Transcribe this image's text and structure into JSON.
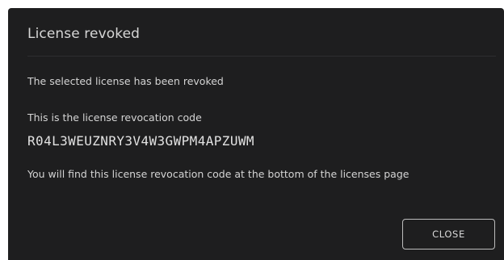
{
  "dialog": {
    "title": "License revoked",
    "message_revoked": "The selected license has been revoked",
    "code_label": "This is the license revocation code",
    "revocation_code": "R04L3WEUZNRY3V4W3GWPM4APZUWM",
    "find_message": "You will find this license revocation code at the bottom of the licenses page",
    "close_label": "CLOSE"
  },
  "colors": {
    "dialog_background": "#1e1e1f",
    "text": "#d4d4d4",
    "button_border": "#bdbdbd"
  }
}
